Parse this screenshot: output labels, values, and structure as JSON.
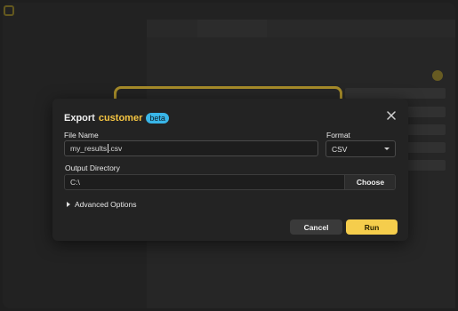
{
  "dialog": {
    "title_prefix": "Export",
    "title_accent": "customer",
    "badge": "beta",
    "file_name": {
      "label": "File Name",
      "value_before_caret": "my_results",
      "value_after_caret": ".csv"
    },
    "format": {
      "label": "Format",
      "selected": "CSV"
    },
    "output_directory": {
      "label": "Output Directory",
      "value": "C:\\",
      "choose_label": "Choose"
    },
    "advanced_label": "Advanced Options",
    "cancel_label": "Cancel",
    "run_label": "Run"
  },
  "colors": {
    "accent": "#f5c542",
    "badge": "#39b6e8",
    "run_button": "#f5cd4c"
  },
  "icons": {
    "close": "close-icon",
    "format_dropdown": "chevron-down-icon",
    "advanced_toggle": "chevron-right-icon",
    "app_logo": "app-logo-icon"
  }
}
